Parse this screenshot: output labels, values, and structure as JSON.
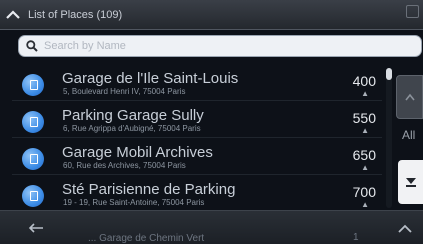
{
  "header": {
    "title": "List of Places (109)",
    "menu_icon": "collapse-up-icon"
  },
  "search": {
    "placeholder": "Search by Name",
    "value": ""
  },
  "places": [
    {
      "name": "Garage de l'Ile Saint-Louis",
      "address": "5, Boulevard Henri IV, 75004 Paris",
      "distance": "400",
      "direction": "▲"
    },
    {
      "name": "Parking Garage Sully",
      "address": "6, Rue Agrippa d'Aubigné, 75004 Paris",
      "distance": "550",
      "direction": "▲"
    },
    {
      "name": "Garage Mobil Archives",
      "address": "60, Rue des Archives, 75004 Paris",
      "distance": "650",
      "direction": "▲"
    },
    {
      "name": "Sté Parisienne de Parking",
      "address": "19 - 19, Rue Saint-Antoine, 75004 Paris",
      "distance": "700",
      "direction": "▲"
    }
  ],
  "partial_row": {
    "name": "... Garage de Chemin Vert",
    "distance": "1"
  },
  "side": {
    "all_label": "All"
  }
}
